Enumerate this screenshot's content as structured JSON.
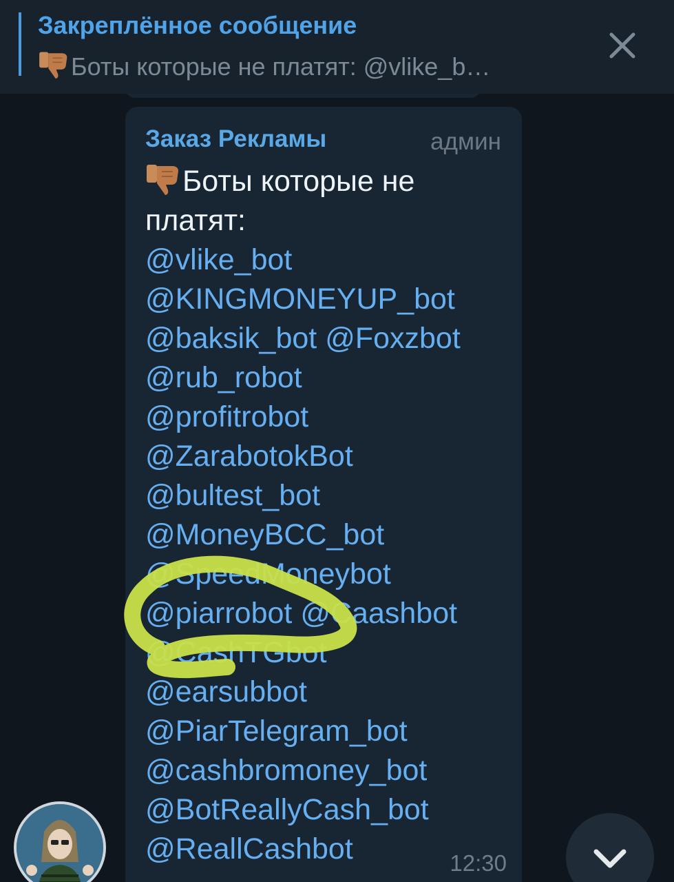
{
  "pinned": {
    "title": "Закреплённое сообщение",
    "preview": "Боты которые не платят: @vlike_b…",
    "preview_icon": "thumbs-down-emoji",
    "close_icon": "close-icon"
  },
  "message": {
    "sender": "Заказ Рекламы",
    "role": "админ",
    "intro": "Боты которые не платят:",
    "intro_icon": "thumbs-down-emoji",
    "lines": [
      [
        "@vlike_bot"
      ],
      [
        "@KINGMONEYUP_bot"
      ],
      [
        "@baksik_bot",
        "@Foxzbot"
      ],
      [
        "@rub_robot"
      ],
      [
        "@profitrobot"
      ],
      [
        "@ZarabotokBot"
      ],
      [
        "@bultest_bot"
      ],
      [
        "@MoneyBCC_bot"
      ],
      [
        "@SpeedMoneybot"
      ],
      [
        "@piarrobot",
        "@Caashbot"
      ],
      [
        "@CashTGbot"
      ],
      [
        "@earsubbot"
      ],
      [
        "@PiarTelegram_bot"
      ],
      [
        "@cashbromoney_bot"
      ],
      [
        "@BotReallyCash_bot"
      ],
      [
        "@ReallCashbot"
      ]
    ],
    "time": "12:30"
  },
  "avatar_icon": "user-avatar",
  "scroll_icon": "chevron-down-icon",
  "colors": {
    "background": "#0f161d",
    "bubble": "#182533",
    "accent": "#4fa3e8",
    "mention": "#66aff0",
    "scribble": "#c9e04a"
  }
}
